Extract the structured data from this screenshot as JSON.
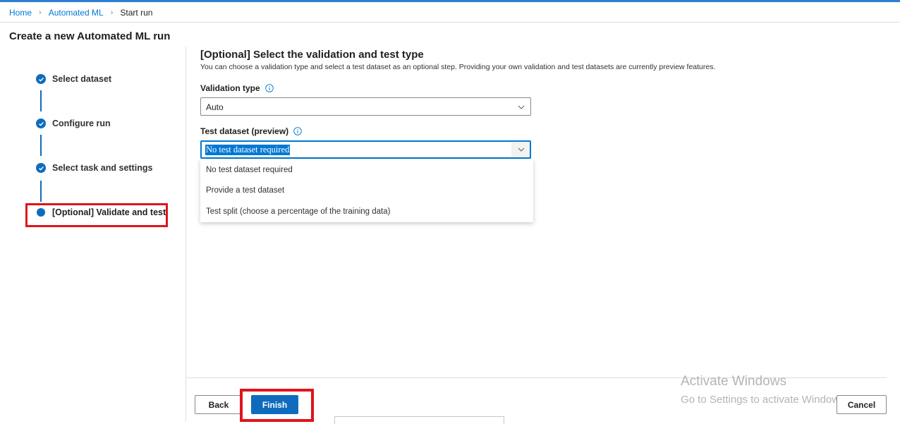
{
  "breadcrumb": {
    "home": "Home",
    "automated_ml": "Automated ML",
    "current": "Start run"
  },
  "page": {
    "title": "Create a new Automated ML run"
  },
  "steps": [
    {
      "label": "Select dataset",
      "status": "complete"
    },
    {
      "label": "Configure run",
      "status": "complete"
    },
    {
      "label": "Select task and settings",
      "status": "complete"
    },
    {
      "label": "[Optional] Validate and test",
      "status": "current"
    }
  ],
  "main": {
    "title": "[Optional] Select the validation and test type",
    "description": "You can choose a validation type and select a test dataset as an optional step. Providing your own validation and test datasets are currently preview features.",
    "validation_type": {
      "label": "Validation type",
      "value": "Auto"
    },
    "test_dataset": {
      "label": "Test dataset (preview)",
      "value": "No test dataset required",
      "options": [
        "No test dataset required",
        "Provide a test dataset",
        "Test split (choose a percentage of the training data)"
      ]
    }
  },
  "footer": {
    "back_label": "Back",
    "finish_label": "Finish",
    "cancel_label": "Cancel"
  },
  "watermark": {
    "line1": "Activate Windows",
    "line2": "Go to Settings to activate Windows."
  },
  "colors": {
    "accent": "#0f6cbd",
    "highlight": "#e0141b",
    "link": "#0078d4"
  },
  "icons": {
    "step_complete": "checkmark-icon",
    "info": "info-icon",
    "dropdown": "chevron-down-icon",
    "breadcrumb_separator": "chevron-right-icon"
  }
}
